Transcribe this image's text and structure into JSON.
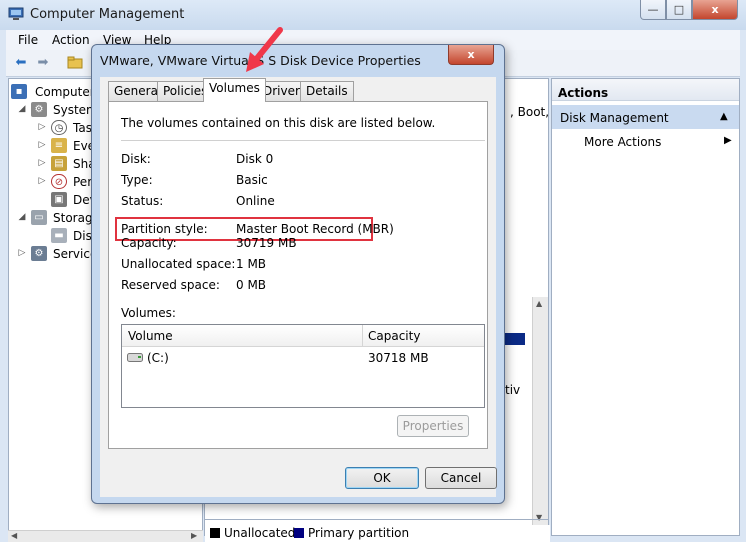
{
  "main_window": {
    "title": "Computer Management",
    "menu": [
      "File",
      "Action",
      "View",
      "Help"
    ],
    "caption_buttons": {
      "minimize": "—",
      "maximize": "□",
      "close": "x"
    }
  },
  "tree": {
    "items": [
      {
        "label": "Computer",
        "expander": "",
        "icon": "computer-icon"
      },
      {
        "label": "System",
        "expander": "◢",
        "icon": "tools-icon"
      },
      {
        "label": "Tas",
        "expander": "▷",
        "icon": "clock-icon"
      },
      {
        "label": "Eve",
        "expander": "▷",
        "icon": "event-viewer-icon"
      },
      {
        "label": "Sha",
        "expander": "▷",
        "icon": "shared-folders-icon"
      },
      {
        "label": "Perf",
        "expander": "▷",
        "icon": "performance-icon"
      },
      {
        "label": "Dev",
        "expander": "",
        "icon": "device-manager-icon"
      },
      {
        "label": "Storage",
        "expander": "◢",
        "icon": "storage-icon"
      },
      {
        "label": "Disk",
        "expander": "",
        "icon": "disk-icon"
      },
      {
        "label": "Service",
        "expander": "▷",
        "icon": "services-icon"
      }
    ]
  },
  "center": {
    "partial_text_1": ", Boot, l",
    "partial_text_2": "tiv"
  },
  "actions": {
    "header": "Actions",
    "section": "Disk Management",
    "more": "More Actions"
  },
  "dialog": {
    "title": "VMware, VMware Virtual S S   Disk Device Properties",
    "close": "x",
    "tabs": [
      "General",
      "Policies",
      "Volumes",
      "Driver",
      "Details"
    ],
    "active_tab": "Volumes",
    "intro": "The volumes contained on this disk are listed below.",
    "fields": [
      {
        "label": "Disk:",
        "value": "Disk 0"
      },
      {
        "label": "Type:",
        "value": "Basic"
      },
      {
        "label": "Status:",
        "value": "Online"
      },
      {
        "label": "Partition style:",
        "value": "Master Boot Record (MBR)"
      },
      {
        "label": "Capacity:",
        "value": "30719 MB"
      },
      {
        "label": "Unallocated space:",
        "value": "1 MB"
      },
      {
        "label": "Reserved space:",
        "value": "0 MB"
      }
    ],
    "volumes_label": "Volumes:",
    "volumes_columns": [
      "Volume",
      "Capacity"
    ],
    "volumes_rows": [
      {
        "volume": "(C:)",
        "capacity": "30718 MB"
      }
    ],
    "properties_button": "Properties",
    "ok_button": "OK",
    "cancel_button": "Cancel"
  },
  "legend": {
    "unallocated": "Unallocated",
    "primary": "Primary partition",
    "unallocated_color": "#000000",
    "primary_color": "#000080"
  },
  "annotation": {
    "highlight_color": "#e0333f"
  }
}
